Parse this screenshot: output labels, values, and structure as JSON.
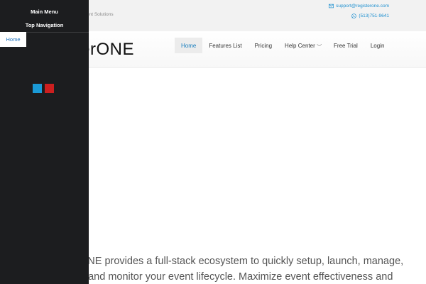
{
  "topbar": {
    "tagline": "ent Solutions",
    "email": "support@registerone.com",
    "phone": "(513)751-9641"
  },
  "header": {
    "logo_text": "terONE"
  },
  "nav": {
    "items": [
      {
        "label": "Home",
        "active": true
      },
      {
        "label": "Features List"
      },
      {
        "label": "Pricing"
      },
      {
        "label": "Help Center",
        "dropdown": true
      },
      {
        "label": "Free Trial"
      },
      {
        "label": "Login"
      }
    ]
  },
  "sidebar": {
    "main_menu": "Main Menu",
    "top_navigation": "Top Navigation",
    "home": "Home"
  },
  "hero": {
    "line1": "ONE provides a full-stack ecosystem to quickly setup, launch, manage,",
    "line2": "n and monitor your event lifecycle. Maximize event effectiveness and"
  },
  "colors": {
    "accent": "#1e90d0",
    "sidebar_bg": "#1c1d1f",
    "swatch_blue": "#1a9ad6",
    "swatch_red": "#cc1f1f"
  },
  "icons": {
    "email": "envelope-icon",
    "phone": "whatsapp-icon",
    "dropdown": "chevron-down-icon"
  }
}
